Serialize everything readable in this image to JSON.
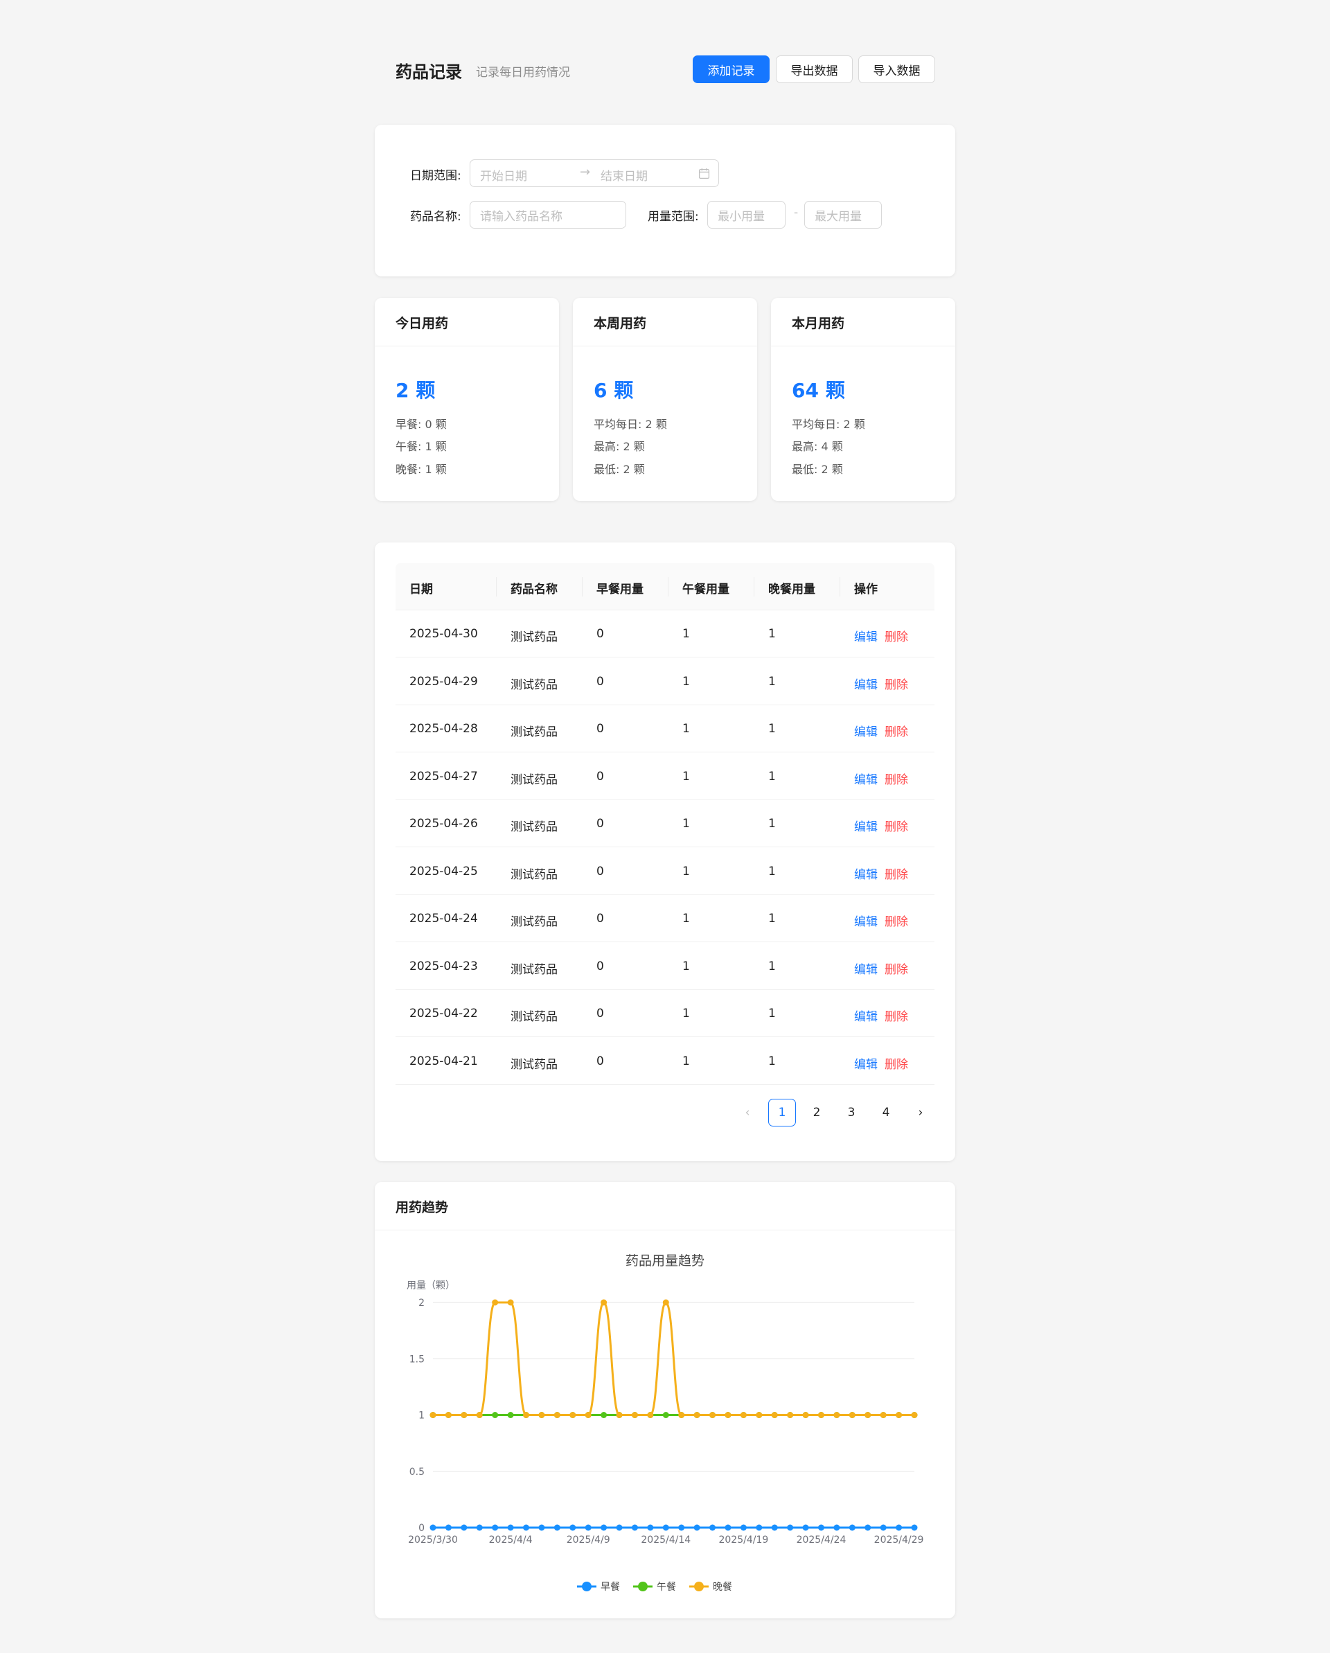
{
  "header": {
    "title": "药品记录",
    "subtitle": "记录每日用药情况",
    "add_label": "添加记录",
    "export_label": "导出数据",
    "import_label": "导入数据"
  },
  "filters": {
    "date_range_label": "日期范围:",
    "start_placeholder": "开始日期",
    "end_placeholder": "结束日期",
    "drug_name_label": "药品名称:",
    "drug_name_placeholder": "请输入药品名称",
    "dose_range_label": "用量范围:",
    "min_placeholder": "最小用量",
    "max_placeholder": "最大用量",
    "range_separator": "-",
    "arrow": "→"
  },
  "stats": [
    {
      "title": "今日用药",
      "value": "2 颗",
      "lines": [
        "早餐: 0 颗",
        "午餐: 1 颗",
        "晚餐: 1 颗"
      ]
    },
    {
      "title": "本周用药",
      "value": "6 颗",
      "lines": [
        "平均每日: 2 颗",
        "最高: 2 颗",
        "最低: 2 颗"
      ]
    },
    {
      "title": "本月用药",
      "value": "64 颗",
      "lines": [
        "平均每日: 2 颗",
        "最高: 4 颗",
        "最低: 2 颗"
      ]
    }
  ],
  "table": {
    "columns": [
      "日期",
      "药品名称",
      "早餐用量",
      "午餐用量",
      "晚餐用量",
      "操作"
    ],
    "edit_label": "编辑",
    "delete_label": "删除",
    "rows": [
      {
        "date": "2025-04-30",
        "name": "测试药品",
        "breakfast": "0",
        "lunch": "1",
        "dinner": "1"
      },
      {
        "date": "2025-04-29",
        "name": "测试药品",
        "breakfast": "0",
        "lunch": "1",
        "dinner": "1"
      },
      {
        "date": "2025-04-28",
        "name": "测试药品",
        "breakfast": "0",
        "lunch": "1",
        "dinner": "1"
      },
      {
        "date": "2025-04-27",
        "name": "测试药品",
        "breakfast": "0",
        "lunch": "1",
        "dinner": "1"
      },
      {
        "date": "2025-04-26",
        "name": "测试药品",
        "breakfast": "0",
        "lunch": "1",
        "dinner": "1"
      },
      {
        "date": "2025-04-25",
        "name": "测试药品",
        "breakfast": "0",
        "lunch": "1",
        "dinner": "1"
      },
      {
        "date": "2025-04-24",
        "name": "测试药品",
        "breakfast": "0",
        "lunch": "1",
        "dinner": "1"
      },
      {
        "date": "2025-04-23",
        "name": "测试药品",
        "breakfast": "0",
        "lunch": "1",
        "dinner": "1"
      },
      {
        "date": "2025-04-22",
        "name": "测试药品",
        "breakfast": "0",
        "lunch": "1",
        "dinner": "1"
      },
      {
        "date": "2025-04-21",
        "name": "测试药品",
        "breakfast": "0",
        "lunch": "1",
        "dinner": "1"
      }
    ]
  },
  "pagination": {
    "pages": [
      "1",
      "2",
      "3",
      "4"
    ],
    "current": "1",
    "prev": "‹",
    "next": "›"
  },
  "chart_section": {
    "title": "用药趋势"
  },
  "chart_data": {
    "type": "line",
    "title": "药品用量趋势",
    "ylabel": "用量（颗）",
    "xlabel": "",
    "x": [
      "2025/3/30",
      "2025/3/31",
      "2025/4/1",
      "2025/4/2",
      "2025/4/3",
      "2025/4/4",
      "2025/4/5",
      "2025/4/6",
      "2025/4/7",
      "2025/4/8",
      "2025/4/9",
      "2025/4/10",
      "2025/4/11",
      "2025/4/12",
      "2025/4/13",
      "2025/4/14",
      "2025/4/15",
      "2025/4/16",
      "2025/4/17",
      "2025/4/18",
      "2025/4/19",
      "2025/4/20",
      "2025/4/21",
      "2025/4/22",
      "2025/4/23",
      "2025/4/24",
      "2025/4/25",
      "2025/4/26",
      "2025/4/27",
      "2025/4/28",
      "2025/4/29",
      "2025/4/30"
    ],
    "x_tick_labels": [
      "2025/3/30",
      "2025/4/4",
      "2025/4/9",
      "2025/4/14",
      "2025/4/19",
      "2025/4/24",
      "2025/4/29"
    ],
    "y_ticks": [
      "0",
      "0.5",
      "1",
      "1.5",
      "2"
    ],
    "ylim": [
      0,
      2
    ],
    "series": [
      {
        "name": "早餐",
        "color": "#1890ff",
        "values": [
          0,
          0,
          0,
          0,
          0,
          0,
          0,
          0,
          0,
          0,
          0,
          0,
          0,
          0,
          0,
          0,
          0,
          0,
          0,
          0,
          0,
          0,
          0,
          0,
          0,
          0,
          0,
          0,
          0,
          0,
          0,
          0
        ]
      },
      {
        "name": "午餐",
        "color": "#52c41a",
        "values": [
          1,
          1,
          1,
          1,
          1,
          1,
          1,
          1,
          1,
          1,
          1,
          1,
          1,
          1,
          1,
          1,
          1,
          1,
          1,
          1,
          1,
          1,
          1,
          1,
          1,
          1,
          1,
          1,
          1,
          1,
          1,
          1
        ]
      },
      {
        "name": "晚餐",
        "color": "#f5b01b",
        "values": [
          1,
          1,
          1,
          1,
          2,
          2,
          1,
          1,
          1,
          1,
          1,
          2,
          1,
          1,
          1,
          2,
          1,
          1,
          1,
          1,
          1,
          1,
          1,
          1,
          1,
          1,
          1,
          1,
          1,
          1,
          1,
          1
        ]
      }
    ],
    "legend": "bottom-center",
    "smooth": true
  }
}
